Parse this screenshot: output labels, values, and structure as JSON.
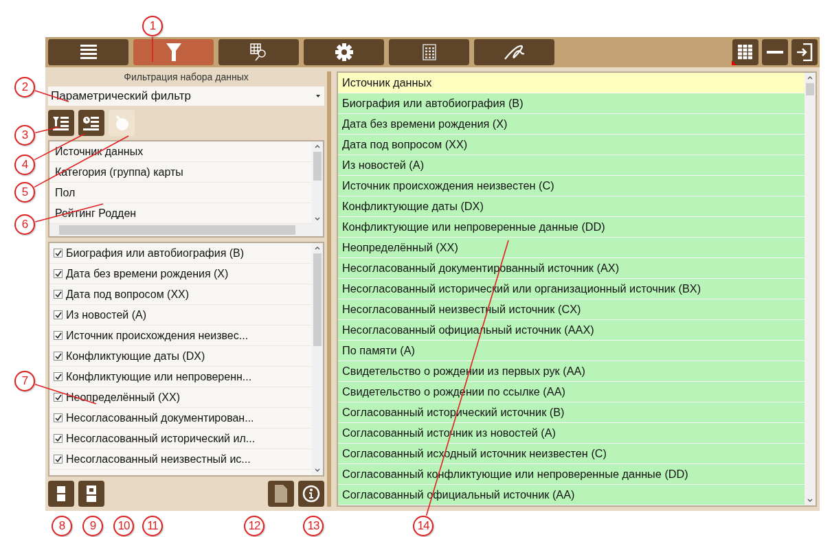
{
  "toolbar": {
    "tabs": [
      {
        "kind": "list",
        "selected": false
      },
      {
        "kind": "filter",
        "selected": true
      },
      {
        "kind": "grid-search",
        "selected": false
      },
      {
        "kind": "gear",
        "selected": false
      },
      {
        "kind": "calculator",
        "selected": false
      },
      {
        "kind": "signature",
        "selected": false
      }
    ],
    "window_buttons": [
      {
        "kind": "grid",
        "badge": true
      },
      {
        "kind": "minimize",
        "badge": false
      },
      {
        "kind": "exit",
        "badge": false
      }
    ]
  },
  "filter_panel": {
    "title": "Фильтрация набора данных",
    "mode": "Параметрический фильтр",
    "tool_buttons": [
      {
        "kind": "filter-list",
        "disabled": false
      },
      {
        "kind": "clock-list",
        "disabled": false
      },
      {
        "kind": "clear",
        "disabled": true
      }
    ],
    "fields": [
      {
        "label": "Источник данных",
        "selected": false
      },
      {
        "label": "Категория (группа) карты",
        "selected": false
      },
      {
        "label": "Пол",
        "selected": false
      },
      {
        "label": "Рейтинг Родден",
        "selected": false
      }
    ],
    "categories": [
      {
        "label": "Биография или автобиография (B)",
        "checked": true
      },
      {
        "label": "Дата без времени рождения (X)",
        "checked": true
      },
      {
        "label": "Дата под вопросом (XX)",
        "checked": true
      },
      {
        "label": "Из новостей (A)",
        "checked": true
      },
      {
        "label": "Источник происхождения неизвес...",
        "checked": true
      },
      {
        "label": "Конфликтующие даты (DX)",
        "checked": true
      },
      {
        "label": "Конфликтующие или непроверенн...",
        "checked": true
      },
      {
        "label": "Неопределённый (XX)",
        "checked": true
      },
      {
        "label": "Несогласованный документирован...",
        "checked": true
      },
      {
        "label": "Несогласованный исторический ил...",
        "checked": true
      },
      {
        "label": "Несогласованный неизвестный ис...",
        "checked": true
      }
    ],
    "bottom_buttons": [
      {
        "kind": "split"
      },
      {
        "kind": "split-dot"
      },
      {
        "kind": "document"
      },
      {
        "kind": "info"
      }
    ]
  },
  "values_list": {
    "items": [
      {
        "label": "Источник данных",
        "selected": true
      },
      {
        "label": "Биография или автобиография (B)",
        "selected": false
      },
      {
        "label": "Дата без времени рождения (X)",
        "selected": false
      },
      {
        "label": "Дата под вопросом (XX)",
        "selected": false
      },
      {
        "label": "Из новостей (A)",
        "selected": false
      },
      {
        "label": "Источник происхождения неизвестен (C)",
        "selected": false
      },
      {
        "label": "Конфликтующие даты (DX)",
        "selected": false
      },
      {
        "label": "Конфликтующие или непроверенные данные (DD)",
        "selected": false
      },
      {
        "label": "Неопределённый (XX)",
        "selected": false
      },
      {
        "label": "Несогласованный документированный источник (AX)",
        "selected": false
      },
      {
        "label": "Несогласованный исторический или организационный источник (BX)",
        "selected": false
      },
      {
        "label": "Несогласованный неизвестный источник (CX)",
        "selected": false
      },
      {
        "label": "Несогласованный официальный источник (AAX)",
        "selected": false
      },
      {
        "label": "По памяти (A)",
        "selected": false
      },
      {
        "label": "Свидетельство о рождении из первых рук (AA)",
        "selected": false
      },
      {
        "label": "Свидетельство о рождении по ссылке (AA)",
        "selected": false
      },
      {
        "label": "Согласованный исторический источник (B)",
        "selected": false
      },
      {
        "label": "Согласованный источник из новостей (A)",
        "selected": false
      },
      {
        "label": "Согласованный исходный источник неизвестен (C)",
        "selected": false
      },
      {
        "label": "Согласованный конфликтующие или непроверенные данные (DD)",
        "selected": false
      },
      {
        "label": "Согласованный официальный источник (AA)",
        "selected": false
      }
    ]
  },
  "callouts": [
    "1",
    "2",
    "3",
    "4",
    "5",
    "6",
    "7",
    "8",
    "9",
    "10",
    "11",
    "12",
    "13",
    "14"
  ]
}
